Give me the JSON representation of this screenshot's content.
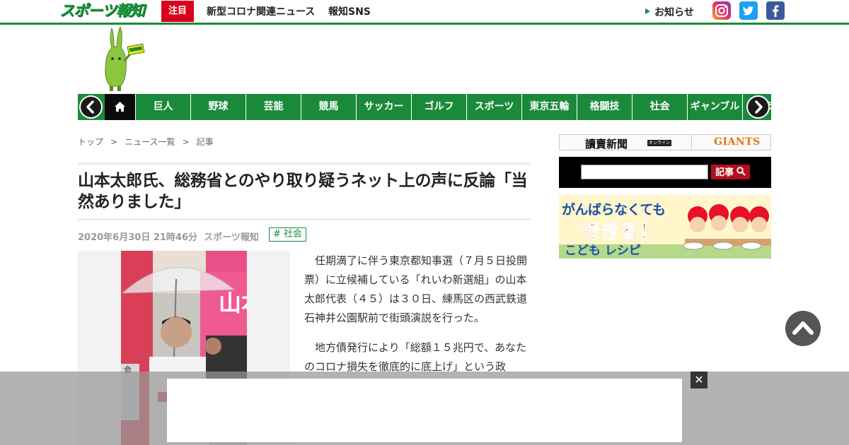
{
  "header": {
    "logo_text": "スポーツ報知",
    "badge": "注目",
    "links": [
      "新型コロナ関連ニュース",
      "報知SNS"
    ],
    "notice": "お知らせ",
    "sns": [
      {
        "name": "instagram",
        "color": "#c13584"
      },
      {
        "name": "twitter",
        "color": "#1da1f2"
      },
      {
        "name": "facebook",
        "color": "#3b5998"
      }
    ]
  },
  "nav": {
    "items": [
      "巨人",
      "野球",
      "芸能",
      "競馬",
      "サッカー",
      "ゴルフ",
      "スポーツ",
      "東京五輪",
      "格闘技",
      "社会",
      "ギャンブル",
      "ラ"
    ]
  },
  "breadcrumb": [
    "トップ",
    ">",
    "ニュース一覧",
    ">",
    "記事"
  ],
  "article": {
    "title": "山本太郎氏、総務省とのやり取り疑うネット上の声に反論「当然ありました」",
    "date": "2020年6月30日 21時46分",
    "source": "スポーツ報知",
    "tag": "# 社会",
    "paragraphs": [
      "任期満了に伴う東京都知事選（７月５日投開票）に立候補している「れいわ新選組」の山本太郎代表（４５）は３０日、練馬区の西武鉄道石神井公園駅前で街頭演説を行った。",
      "地方債発行により「総額１５兆円で、あなたのコロナ損失を徹底的に底上げ」という政"
    ],
    "photo_sign": "山本",
    "photo_small": "会"
  },
  "sidebar": {
    "yomiuri": "讀賣新聞",
    "online": "オンライン",
    "giants": "GIANTS",
    "search_placeholder": "",
    "search_button": "記事",
    "banner_line1": "がんばらなくても",
    "banner_line2": "できる！",
    "banner_line3": "こども レシピ"
  },
  "overlay": {
    "close": "✕"
  },
  "colors": {
    "brand_green": "#1a8a3a",
    "accent_red": "#d9001b"
  }
}
